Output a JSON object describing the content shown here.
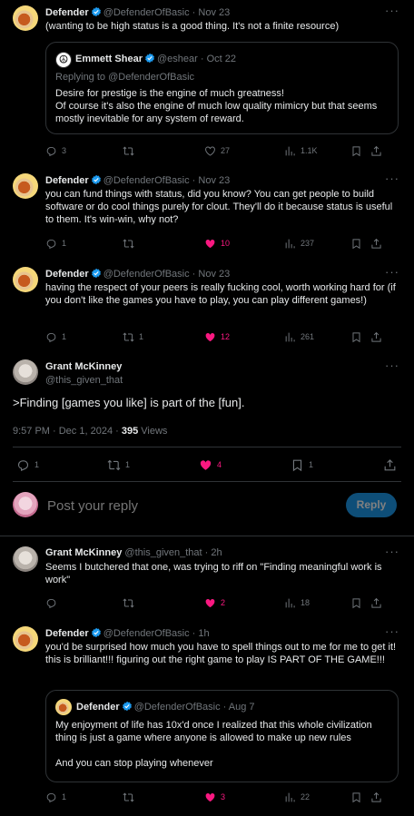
{
  "tweets": [
    {
      "name": "Defender",
      "handle": "@DefenderOfBasic",
      "time": "Nov 23",
      "text": "(wanting to be high status is a good thing. It's not a finite resource)",
      "quote": {
        "name": "Emmett Shear",
        "handle": "@eshear",
        "time": "Oct 22",
        "replying": "Replying to @DefenderOfBasic",
        "text": "Desire for prestige is the engine of much greatness!\nOf course it's also the engine of much low quality mimicry but that seems mostly inevitable for any system of reward."
      },
      "replies": "3",
      "retweets": "",
      "likes": "27",
      "views": "1.1K"
    },
    {
      "name": "Defender",
      "handle": "@DefenderOfBasic",
      "time": "Nov 23",
      "text": "you can fund things with status, did you know? You can get people to build software or do cool things purely for clout. They'll do it because status is useful to them. It's win-win, why not?",
      "replies": "1",
      "retweets": "",
      "likes": "10",
      "views": "237"
    },
    {
      "name": "Defender",
      "handle": "@DefenderOfBasic",
      "time": "Nov 23",
      "text": "having the respect of your peers is really fucking cool, worth working hard for (if you don't like the games you have to play, you can play different games!)",
      "replies": "1",
      "retweets": "1",
      "likes": "12",
      "views": "261"
    }
  ],
  "main": {
    "name": "Grant McKinney",
    "handle": "@this_given_that",
    "text": ">Finding [games you like] is part of the [fun].",
    "timestamp": "9:57 PM · Dec 1, 2024 · ",
    "views_count": "395",
    "views_label": " Views",
    "replies": "1",
    "retweets": "1",
    "likes": "4",
    "bookmarks": "1"
  },
  "composer": {
    "placeholder": "Post your reply",
    "button": "Reply"
  },
  "replies": [
    {
      "name": "Grant McKinney",
      "handle": "@this_given_that",
      "time": "2h",
      "text": "Seems I butchered that one, was trying to riff on \"Finding meaningful work is work\"",
      "replies": "",
      "retweets": "",
      "likes": "2",
      "views": "18"
    },
    {
      "name": "Defender",
      "handle": "@DefenderOfBasic",
      "time": "1h",
      "text": "you'd be surprised how much you have to spell things out to me for me to get it! this is brilliant!!! figuring out the right game to play IS PART OF THE GAME!!!",
      "quote": {
        "name": "Defender",
        "handle": "@DefenderOfBasic",
        "time": "Aug 7",
        "text": "My enjoyment of life has 10x'd once I realized that this whole civilization thing is just a game where anyone is allowed to make up new rules\n\nAnd you can stop playing whenever"
      },
      "replies": "1",
      "retweets": "",
      "likes": "3",
      "views": "22"
    }
  ],
  "colors": {
    "like": "#f91880",
    "verified": "#1d9bf0",
    "muted": "#71767b",
    "border": "#2f3336"
  }
}
